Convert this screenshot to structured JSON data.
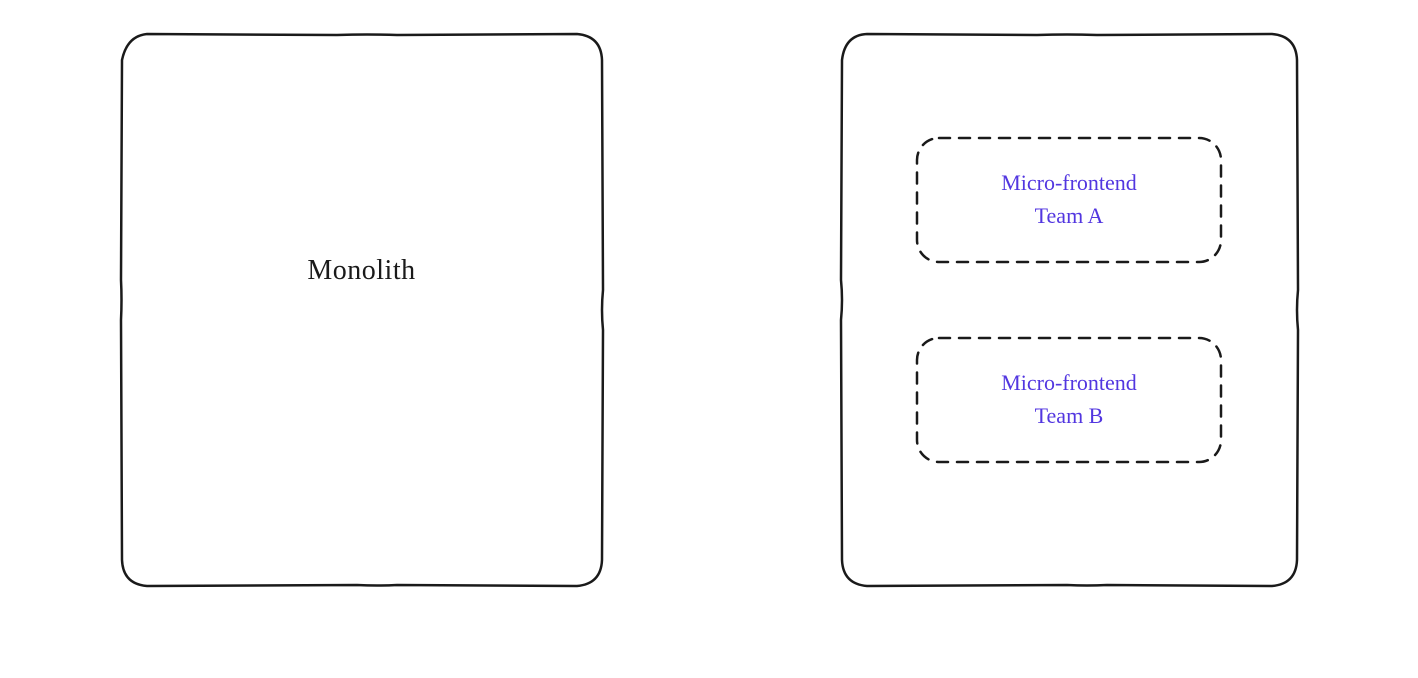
{
  "left": {
    "label": "Monolith"
  },
  "right": {
    "items": [
      {
        "line1": "Micro-frontend",
        "line2": "Team A"
      },
      {
        "line1": "Micro-frontend",
        "line2": "Team B"
      }
    ]
  },
  "colors": {
    "accent": "#5236e0",
    "stroke": "#1a1a1a"
  }
}
